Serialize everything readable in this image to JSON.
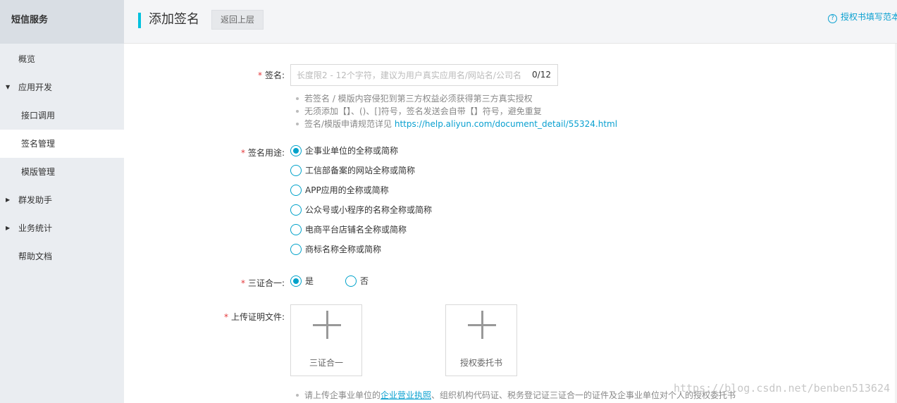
{
  "sidebar": {
    "title": "短信服务",
    "items": [
      {
        "label": "概览"
      },
      {
        "label": "应用开发",
        "caret": "▼"
      },
      {
        "label": "接口调用"
      },
      {
        "label": "签名管理"
      },
      {
        "label": "模版管理"
      },
      {
        "label": "群发助手",
        "caret": "▶"
      },
      {
        "label": "业务统计",
        "caret": "▶"
      },
      {
        "label": "帮助文档"
      }
    ],
    "active_item": "签名管理"
  },
  "header": {
    "title": "添加签名",
    "back_label": "返回上层",
    "help_icon": "?",
    "help_link": "授权书填写范本"
  },
  "form": {
    "required_mark": "*",
    "sign": {
      "label": "签名:",
      "placeholder": "长度限2 - 12个字符，建议为用户真实应用名/网站名/公司名",
      "value": "",
      "counter": "0/12",
      "tips": [
        "若签名 / 模版内容侵犯到第三方权益必须获得第三方真实授权",
        "无须添加【】、()、[]符号，签名发送会自带【】符号，避免重复"
      ],
      "tip_link_prefix": "签名/模版申请规范详见 ",
      "tip_link": "https://help.aliyun.com/document_detail/55324.html"
    },
    "usage": {
      "label": "签名用途:",
      "options": [
        "企事业单位的全称或简称",
        "工信部备案的网站全称或简称",
        "APP应用的全称或简称",
        "公众号或小程序的名称全称或简称",
        "电商平台店铺名全称或简称",
        "商标名称全称或简称"
      ],
      "selected": "企事业单位的全称或简称"
    },
    "three_in_one": {
      "label": "三证合一:",
      "options": [
        "是",
        "否"
      ],
      "selected": "是"
    },
    "upload": {
      "label": "上传证明文件:",
      "boxes": [
        "三证合一",
        "授权委托书"
      ],
      "plus_icon": "plus-icon"
    },
    "bottom_tip_prefix": "请上传企事业单位的",
    "bottom_tip_link": "企业营业执照",
    "bottom_tip_suffix": "、组织机构代码证、税务登记证三证合一的证件及企事业单位对个人的授权委托书"
  },
  "watermark": "https://blog.csdn.net/benben513624",
  "colors": {
    "accent": "#00c1de",
    "link": "#0aa0d0",
    "required": "#e4393c",
    "radio": "#00a2ca"
  }
}
